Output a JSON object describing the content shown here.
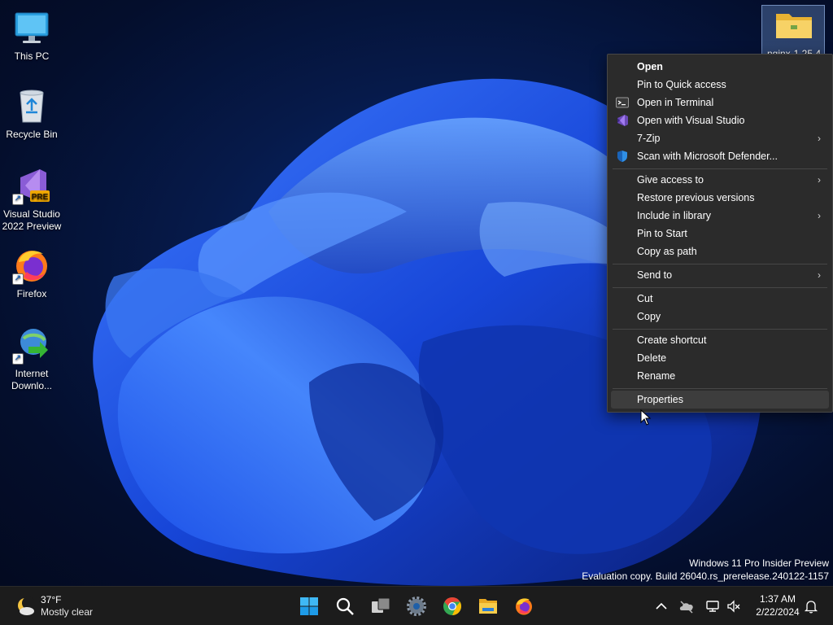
{
  "desktop": {
    "icons": [
      {
        "label": "This PC",
        "icon": "this-pc-icon"
      },
      {
        "label": "Recycle Bin",
        "icon": "recycle-bin-icon"
      },
      {
        "label": "Visual Studio 2022 Preview",
        "icon": "visual-studio-preview-icon",
        "badge": "PRE"
      },
      {
        "label": "Firefox",
        "icon": "firefox-icon"
      },
      {
        "label": "Internet Downlo...",
        "icon": "internet-download-manager-icon"
      }
    ],
    "selected_folder": {
      "label": "nginx-1.25.4",
      "icon": "folder-icon"
    }
  },
  "context_menu": {
    "items": [
      {
        "label": "Open",
        "bold": true
      },
      {
        "label": "Pin to Quick access"
      },
      {
        "label": "Open in Terminal",
        "icon": "terminal-icon"
      },
      {
        "label": "Open with Visual Studio",
        "icon": "visual-studio-icon"
      },
      {
        "label": "7-Zip",
        "submenu": true
      },
      {
        "label": "Scan with Microsoft Defender...",
        "icon": "defender-shield-icon"
      },
      {
        "label": "Give access to",
        "submenu": true
      },
      {
        "label": "Restore previous versions"
      },
      {
        "label": "Include in library",
        "submenu": true
      },
      {
        "label": "Pin to Start"
      },
      {
        "label": "Copy as path"
      },
      {
        "label": "Send to",
        "submenu": true
      },
      {
        "label": "Cut"
      },
      {
        "label": "Copy"
      },
      {
        "label": "Create shortcut"
      },
      {
        "label": "Delete"
      },
      {
        "label": "Rename"
      },
      {
        "label": "Properties",
        "hover": true
      }
    ],
    "submenu_arrow": "›"
  },
  "watermark": {
    "line1": "Windows 11 Pro Insider Preview",
    "line2": "Evaluation copy. Build 26040.rs_prerelease.240122-1157"
  },
  "taskbar": {
    "weather": {
      "temp": "37°F",
      "condition": "Mostly clear",
      "icon": "moon-cloud-icon"
    },
    "apps": [
      "start-icon",
      "search-icon",
      "task-view-icon",
      "settings-icon",
      "chrome-icon",
      "file-explorer-icon",
      "firefox-icon"
    ],
    "tray": [
      "chevron-up-icon",
      "onedrive-icon",
      "network-icon",
      "volume-muted-icon",
      "notifications-icon"
    ],
    "clock": {
      "time": "1:37 AM",
      "date": "2/22/2024"
    }
  }
}
